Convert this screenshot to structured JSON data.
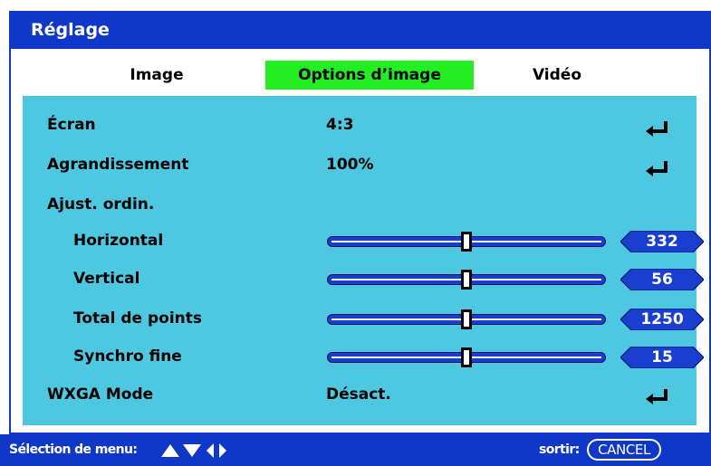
{
  "window": {
    "title": "Réglage"
  },
  "tabs": [
    {
      "label": "Image"
    },
    {
      "label": "Options d’image",
      "active": true
    },
    {
      "label": "Vidéo"
    }
  ],
  "rows": {
    "ecran": {
      "label": "Écran",
      "value": "4:3",
      "icon": "enter-icon"
    },
    "agrandissement": {
      "label": "Agrandissement",
      "value": "100%",
      "icon": "enter-icon"
    },
    "ajust": {
      "label": "Ajust. ordin."
    },
    "horizontal": {
      "label": "Horizontal",
      "value": "332",
      "level": 0.5
    },
    "vertical": {
      "label": "Vertical",
      "value": "56",
      "level": 0.5
    },
    "total": {
      "label": "Total de points",
      "value": "1250",
      "level": 0.5
    },
    "synchro": {
      "label": "Synchro fine",
      "value": "15",
      "level": 0.5
    },
    "wxga": {
      "label": "WXGA Mode",
      "value": "Désact.",
      "icon": "enter-icon"
    }
  },
  "status": {
    "select_label": "Sélection de menu:",
    "select_icons": "up-down-left-right-arrows-icon",
    "exit_label": "sortir:",
    "cancel_key": "CANCEL"
  },
  "colors": {
    "titlebar": "#1038c8",
    "active_tab": "#22ee22",
    "menu_bg": "#4ec8e0",
    "slider": "#1a3fd0"
  }
}
